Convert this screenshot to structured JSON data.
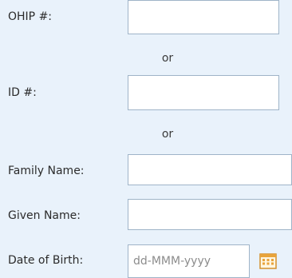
{
  "form": {
    "ohip_label": "OHIP #:",
    "or_1": "or",
    "id_label": "ID #:",
    "or_2": "or",
    "family_name_label": "Family Name:",
    "given_name_label": "Given Name:",
    "dob_label": "Date of Birth:",
    "ohip_value": "",
    "id_value": "",
    "family_name_value": "",
    "given_name_value": "",
    "dob_placeholder": "dd-MMM-yyyy",
    "calendar_icon": "calendar-icon"
  },
  "colors": {
    "background": "#e9f2fb",
    "input_border": "#9fb4c8",
    "calendar_accent": "#e8a33a"
  }
}
